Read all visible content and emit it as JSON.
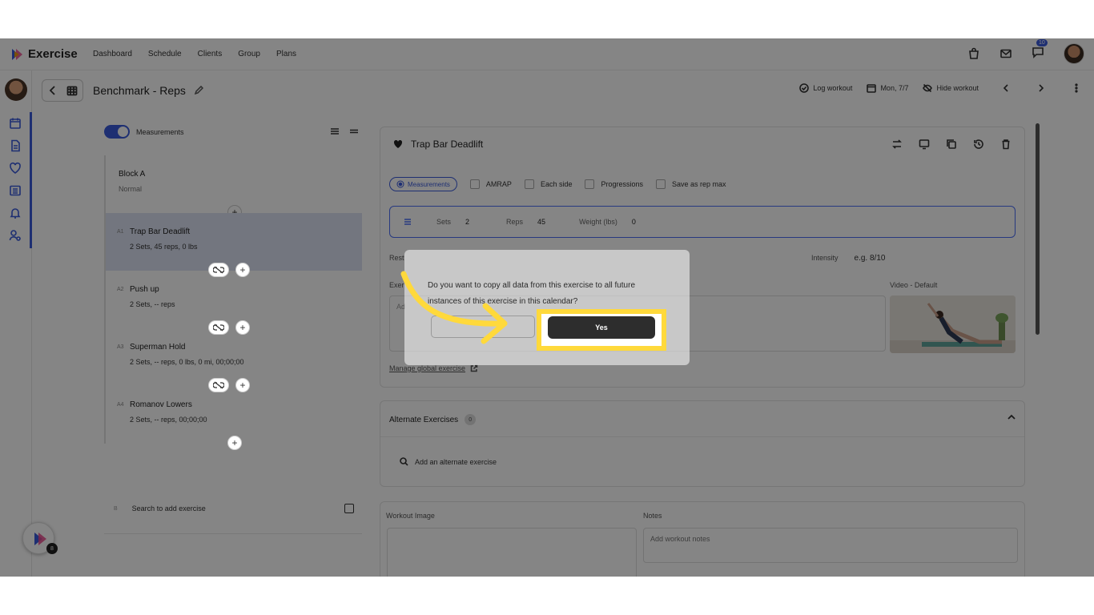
{
  "app": {
    "name": "Exercise"
  },
  "nav": {
    "links": [
      "Dashboard",
      "Schedule",
      "Clients",
      "Group",
      "Plans"
    ],
    "messages_badge": "10"
  },
  "subheader": {
    "title": "Benchmark - Reps",
    "log_workout": "Log workout",
    "date": "Mon, 7/7",
    "hide_workout": "Hide workout"
  },
  "left_panel": {
    "toggle_label": "Measurements",
    "block": {
      "title": "Block A",
      "subtitle": "Normal"
    },
    "exercises": [
      {
        "num": "A1",
        "name": "Trap Bar Deadlift",
        "detail": "2 Sets, 45 reps, 0 lbs"
      },
      {
        "num": "A2",
        "name": "Push up",
        "detail": "2 Sets, -- reps"
      },
      {
        "num": "A3",
        "name": "Superman Hold",
        "detail": "2 Sets, -- reps, 0 lbs, 0 mi, 00;00;00"
      },
      {
        "num": "A4",
        "name": "Romanov Lowers",
        "detail": "2 Sets, -- reps, 00;00;00"
      }
    ],
    "search_hash": "B",
    "search_placeholder": "Search to add exercise"
  },
  "exercise_card": {
    "name": "Trap Bar Deadlift",
    "options": {
      "measurements": "Measurements",
      "amrap": "AMRAP",
      "each_side": "Each side",
      "progressions": "Progressions",
      "save_rep_max": "Save as rep max"
    },
    "sets_label": "Sets",
    "sets_value": "2",
    "reps_label": "Reps",
    "reps_value": "45",
    "weight_label": "Weight (lbs)",
    "weight_value": "0",
    "rest_label": "Rest",
    "intensity_label": "Intensity",
    "intensity_placeholder": "e.g. 8/10",
    "exercise_label": "Exer",
    "notes_placeholder": "Ad",
    "video_label": "Video - Default",
    "manage_link": "Manage global exercise"
  },
  "alternates": {
    "title": "Alternate Exercises",
    "count": "0",
    "search_placeholder": "Add an alternate exercise"
  },
  "workout": {
    "image_label": "Workout Image",
    "notes_label": "Notes",
    "notes_placeholder": "Add workout notes"
  },
  "help": {
    "badge": "8"
  },
  "modal": {
    "message": "Do you want to copy all data from this exercise to all future instances of this exercise in this calendar?",
    "confirm_label": "Yes"
  },
  "colors": {
    "accent": "#3b5bdb",
    "highlight": "#ffd93b",
    "button": "#2d2d2d"
  }
}
